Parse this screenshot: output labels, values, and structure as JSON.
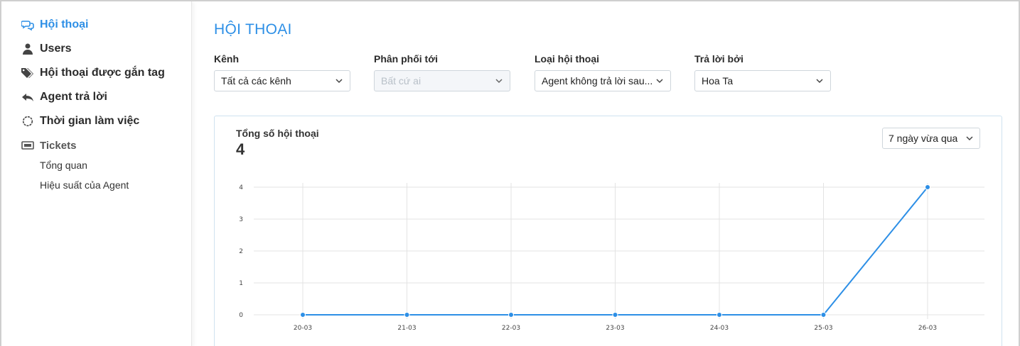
{
  "sidebar": {
    "items": [
      {
        "label": "Hội thoại",
        "icon": "chat-bubbles-icon",
        "active": true
      },
      {
        "label": "Users",
        "icon": "user-icon"
      },
      {
        "label": "Hội thoại được gắn tag",
        "icon": "tags-icon"
      },
      {
        "label": "Agent trả lời",
        "icon": "reply-all-icon"
      },
      {
        "label": "Thời gian làm việc",
        "icon": "clock-icon"
      },
      {
        "label": "Tickets",
        "icon": "ticket-icon"
      }
    ],
    "subitems": [
      {
        "label": "Tổng quan"
      },
      {
        "label": "Hiệu suất của Agent"
      }
    ]
  },
  "main": {
    "title": "HỘI THOẠI",
    "filters": [
      {
        "label": "Kênh",
        "value": "Tất cả các kênh",
        "disabled": false
      },
      {
        "label": "Phân phối tới",
        "value": "Bất cứ ai",
        "disabled": true
      },
      {
        "label": "Loại hội thoại",
        "value": "Agent không trả lời sau...",
        "disabled": false
      },
      {
        "label": "Trả lời bởi",
        "value": "Hoa Ta",
        "disabled": false
      }
    ],
    "card": {
      "title": "Tổng số hội thoại",
      "value": "4",
      "range_label": "7 ngày vừa qua"
    }
  },
  "colors": {
    "accent": "#2d8fe6",
    "line": "#2d8fe6",
    "grid": "#e3e3e3"
  },
  "chart_data": {
    "type": "line",
    "categories": [
      "20-03",
      "21-03",
      "22-03",
      "23-03",
      "24-03",
      "25-03",
      "26-03"
    ],
    "values": [
      0,
      0,
      0,
      0,
      0,
      0,
      4
    ],
    "ylim": [
      0,
      4
    ],
    "yticks": [
      "0",
      "1",
      "2",
      "3",
      "4"
    ],
    "grid": true
  }
}
